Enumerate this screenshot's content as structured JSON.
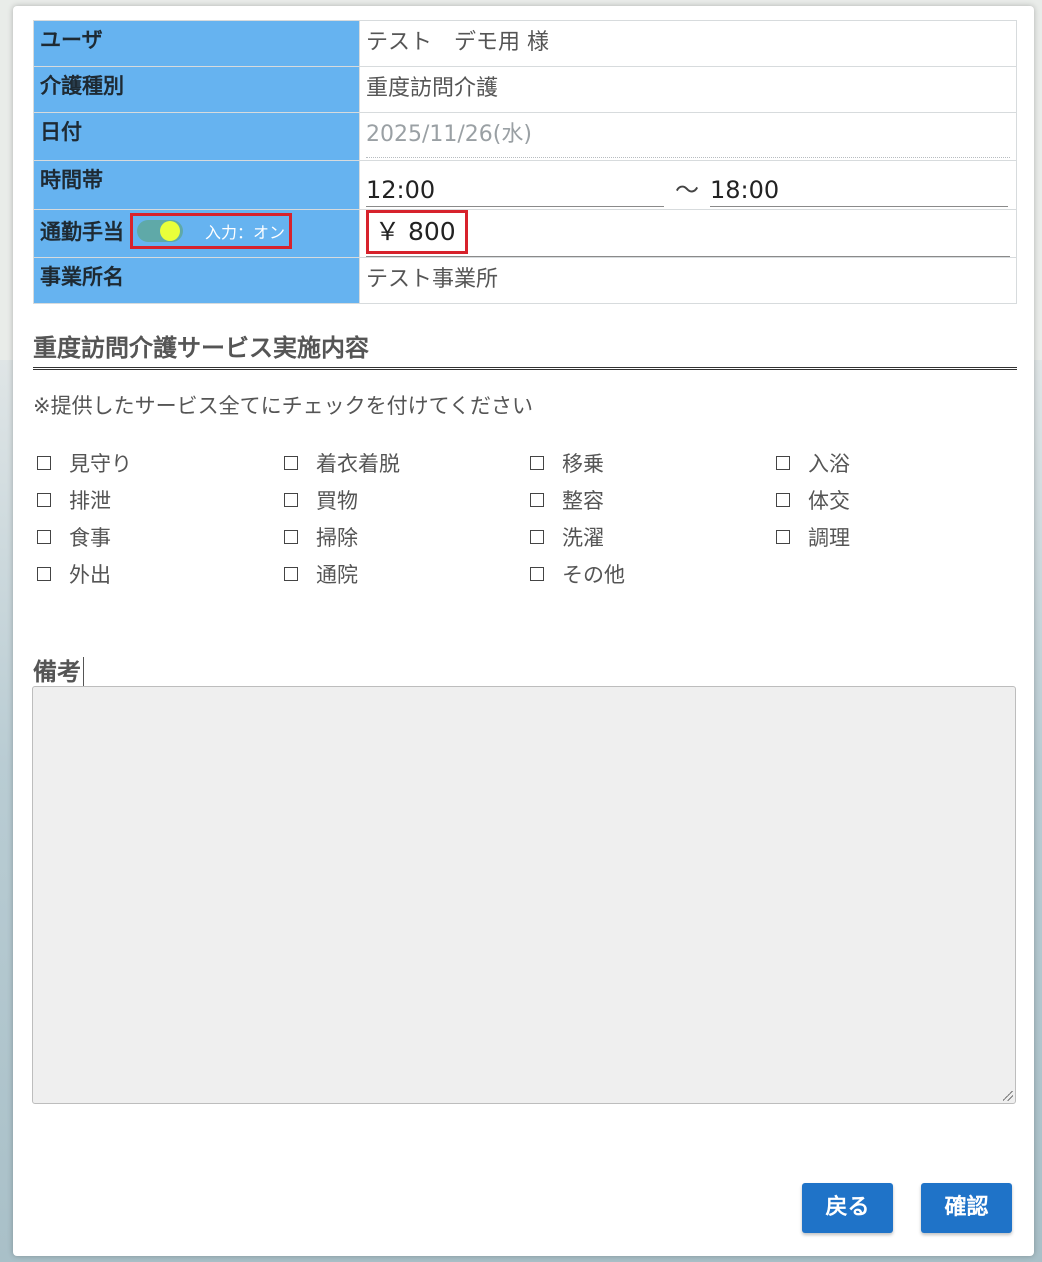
{
  "info_table": {
    "user_label": "ユーザ",
    "user_value": "テスト　デモ用 様",
    "care_type_label": "介護種別",
    "care_type_value": "重度訪問介護",
    "date_label": "日付",
    "date_value": "2025/11/26(水)",
    "time_label": "時間帯",
    "time_start": "12:00",
    "time_separator": "～",
    "time_end": "18:00",
    "commute_label": "通勤手当",
    "commute_toggle_label": "入力：オン",
    "commute_toggle_on": true,
    "commute_fee_value": "￥ 800",
    "office_label": "事業所名",
    "office_value": "テスト事業所"
  },
  "service_section": {
    "title": "重度訪問介護サービス実施内容",
    "note": "※提供したサービス全てにチェックを付けてください",
    "items": [
      {
        "label": "見守り",
        "checked": false
      },
      {
        "label": "着衣着脱",
        "checked": false
      },
      {
        "label": "移乗",
        "checked": false
      },
      {
        "label": "入浴",
        "checked": false
      },
      {
        "label": "排泄",
        "checked": false
      },
      {
        "label": "買物",
        "checked": false
      },
      {
        "label": "整容",
        "checked": false
      },
      {
        "label": "体交",
        "checked": false
      },
      {
        "label": "食事",
        "checked": false
      },
      {
        "label": "掃除",
        "checked": false
      },
      {
        "label": "洗濯",
        "checked": false
      },
      {
        "label": "調理",
        "checked": false
      },
      {
        "label": "外出",
        "checked": false
      },
      {
        "label": "通院",
        "checked": false
      },
      {
        "label": "その他",
        "checked": false
      }
    ]
  },
  "remarks": {
    "label": "備考",
    "value": ""
  },
  "buttons": {
    "back_label": "戻る",
    "confirm_label": "確認"
  },
  "colors": {
    "label_bg": "#66b3f0",
    "highlight_border": "#d7222c",
    "button_bg": "#1f73c8",
    "toggle_track": "#5fa9a8",
    "toggle_knob": "#e9ff3a"
  }
}
